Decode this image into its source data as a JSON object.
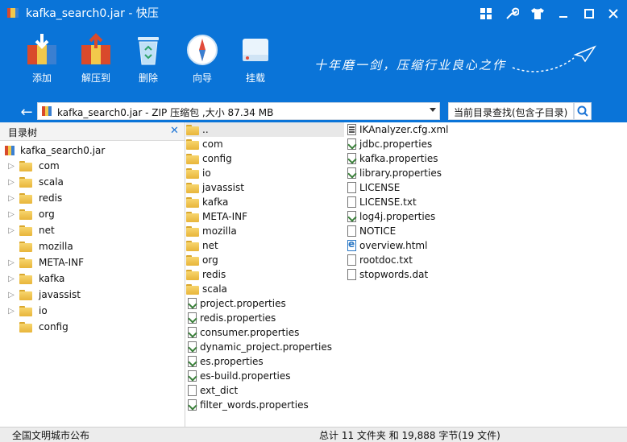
{
  "window": {
    "title": "kafka_search0.jar - 快压",
    "controls": [
      "grid-icon",
      "settings-wrench-icon",
      "skin-icon",
      "minimize-icon",
      "maximize-icon",
      "close-icon"
    ]
  },
  "toolbar": {
    "buttons": [
      {
        "label": "添加",
        "icon": "add-archive-icon"
      },
      {
        "label": "解压到",
        "icon": "extract-to-icon"
      },
      {
        "label": "删除",
        "icon": "recycle-bin-icon"
      },
      {
        "label": "向导",
        "icon": "compass-icon"
      },
      {
        "label": "挂载",
        "icon": "mount-drive-icon"
      }
    ],
    "slogan": "十年磨一剑，压缩行业良心之作"
  },
  "pathbar": {
    "text": "kafka_search0.jar - ZIP 压缩包 ,大小 87.34 MB"
  },
  "search": {
    "label": "当前目录查找(包含子目录)"
  },
  "tree": {
    "header": "目录树",
    "root": "kafka_search0.jar",
    "items": [
      {
        "label": "com",
        "expandable": true
      },
      {
        "label": "scala",
        "expandable": true
      },
      {
        "label": "redis",
        "expandable": true
      },
      {
        "label": "org",
        "expandable": true
      },
      {
        "label": "net",
        "expandable": true
      },
      {
        "label": "mozilla",
        "expandable": false
      },
      {
        "label": "META-INF",
        "expandable": true
      },
      {
        "label": "kafka",
        "expandable": true
      },
      {
        "label": "javassist",
        "expandable": true
      },
      {
        "label": "io",
        "expandable": true
      },
      {
        "label": "config",
        "expandable": false
      }
    ]
  },
  "files": {
    "column1": [
      {
        "name": "..",
        "type": "folder"
      },
      {
        "name": "com",
        "type": "folder"
      },
      {
        "name": "config",
        "type": "folder"
      },
      {
        "name": "io",
        "type": "folder"
      },
      {
        "name": "javassist",
        "type": "folder"
      },
      {
        "name": "kafka",
        "type": "folder"
      },
      {
        "name": "META-INF",
        "type": "folder"
      },
      {
        "name": "mozilla",
        "type": "folder"
      },
      {
        "name": "net",
        "type": "folder"
      },
      {
        "name": "org",
        "type": "folder"
      },
      {
        "name": "redis",
        "type": "folder"
      },
      {
        "name": "scala",
        "type": "folder"
      },
      {
        "name": "project.properties",
        "type": "prop"
      },
      {
        "name": "redis.properties",
        "type": "prop"
      },
      {
        "name": "consumer.properties",
        "type": "prop"
      },
      {
        "name": "dynamic_project.properties",
        "type": "prop"
      },
      {
        "name": "es.properties",
        "type": "prop"
      },
      {
        "name": "es-build.properties",
        "type": "prop"
      },
      {
        "name": "ext_dict",
        "type": "doc"
      },
      {
        "name": "filter_words.properties",
        "type": "prop"
      }
    ],
    "column2": [
      {
        "name": "IKAnalyzer.cfg.xml",
        "type": "xml"
      },
      {
        "name": "jdbc.properties",
        "type": "prop"
      },
      {
        "name": "kafka.properties",
        "type": "prop"
      },
      {
        "name": "library.properties",
        "type": "prop"
      },
      {
        "name": "LICENSE",
        "type": "doc"
      },
      {
        "name": "LICENSE.txt",
        "type": "doc"
      },
      {
        "name": "log4j.properties",
        "type": "prop"
      },
      {
        "name": "NOTICE",
        "type": "doc"
      },
      {
        "name": "overview.html",
        "type": "html"
      },
      {
        "name": "rootdoc.txt",
        "type": "doc"
      },
      {
        "name": "stopwords.dat",
        "type": "doc"
      }
    ]
  },
  "status": {
    "left": "全国文明城市公布",
    "right": "总计 11 文件夹 和 19,888 字节(19 文件)"
  },
  "colors": {
    "titlebar": "#0a74d8",
    "folder": "#f2c84b",
    "accent": "#1b74d6"
  }
}
